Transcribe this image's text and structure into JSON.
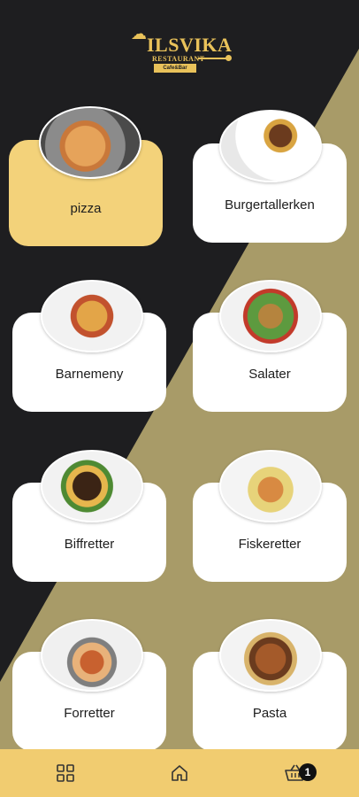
{
  "brand": {
    "name": "ILSVIKA",
    "subtitle": "RESTAURANT",
    "tagline": "Cafe&Bar"
  },
  "categories": [
    {
      "label": "pizza",
      "active": true
    },
    {
      "label": "Burgertallerken",
      "active": false
    },
    {
      "label": "Barnemeny",
      "active": false
    },
    {
      "label": "Salater",
      "active": false
    },
    {
      "label": "Biffretter",
      "active": false
    },
    {
      "label": "Fiskeretter",
      "active": false
    },
    {
      "label": "Forretter",
      "active": false
    },
    {
      "label": "Pasta",
      "active": false
    }
  ],
  "nav": {
    "items": [
      {
        "icon": "grid-icon"
      },
      {
        "icon": "home-icon"
      },
      {
        "icon": "basket-icon"
      }
    ],
    "cart_count": "1"
  },
  "colors": {
    "dark_bg": "#1e1e20",
    "olive_bg": "#a89b68",
    "accent": "#f3d27a",
    "nav_bg": "#f1cc70"
  }
}
